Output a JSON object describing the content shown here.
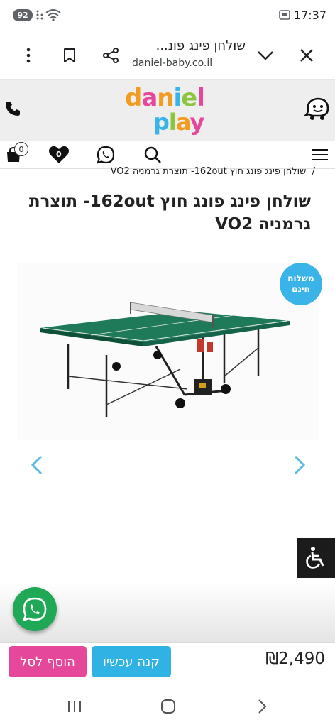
{
  "status_bar": {
    "battery": "92",
    "time": "17:37"
  },
  "browser": {
    "tab_title": "שולחן פינג פונ...",
    "domain": "daniel-baby.co.il",
    "icons": [
      "close-icon",
      "chevron-down-icon",
      "share-icon",
      "bookmark-icon",
      "more-vert-icon"
    ]
  },
  "site": {
    "logo_line1": "daniel",
    "logo_line2": "play",
    "cart_count": "0",
    "wishlist_count": "0",
    "colors": {
      "accent_pink": "#e5479b",
      "accent_blue": "#31b2e4",
      "whatsapp_green": "#1fa855"
    }
  },
  "product": {
    "breadcrumb_sep": "/",
    "breadcrumb": "שולחן פינג פונג חוץ 162out- תוצרת גרמניה VO2",
    "title": "שולחן פינג פונג חוץ 162out- תוצרת גרמניה VO2",
    "shipping_badge_line1": "משלוח",
    "shipping_badge_line2": "חינם",
    "price": "₪2,490",
    "buy_now_label": "קנה עכשיו",
    "add_to_cart_label": "הוסף לסל"
  }
}
